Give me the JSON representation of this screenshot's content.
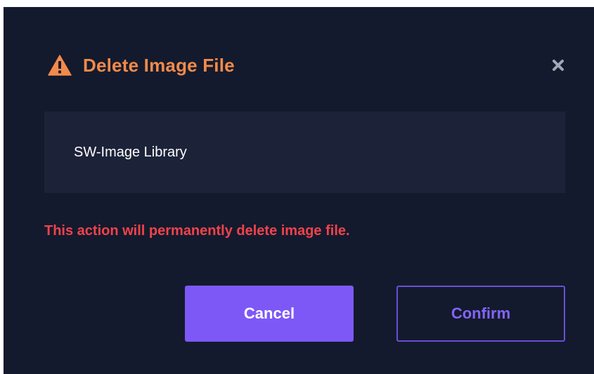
{
  "dialog": {
    "title": "Delete Image File",
    "title_icon": "warning-triangle-icon",
    "close_icon": "close-icon",
    "item_name": "SW-Image Library",
    "warning_text": "This action will permanently delete image file.",
    "cancel_label": "Cancel",
    "confirm_label": "Confirm"
  },
  "colors": {
    "background": "#131a2d",
    "panel": "#1c2339",
    "title": "#f28a4a",
    "warning": "#f2424b",
    "accent": "#7d58f7"
  }
}
